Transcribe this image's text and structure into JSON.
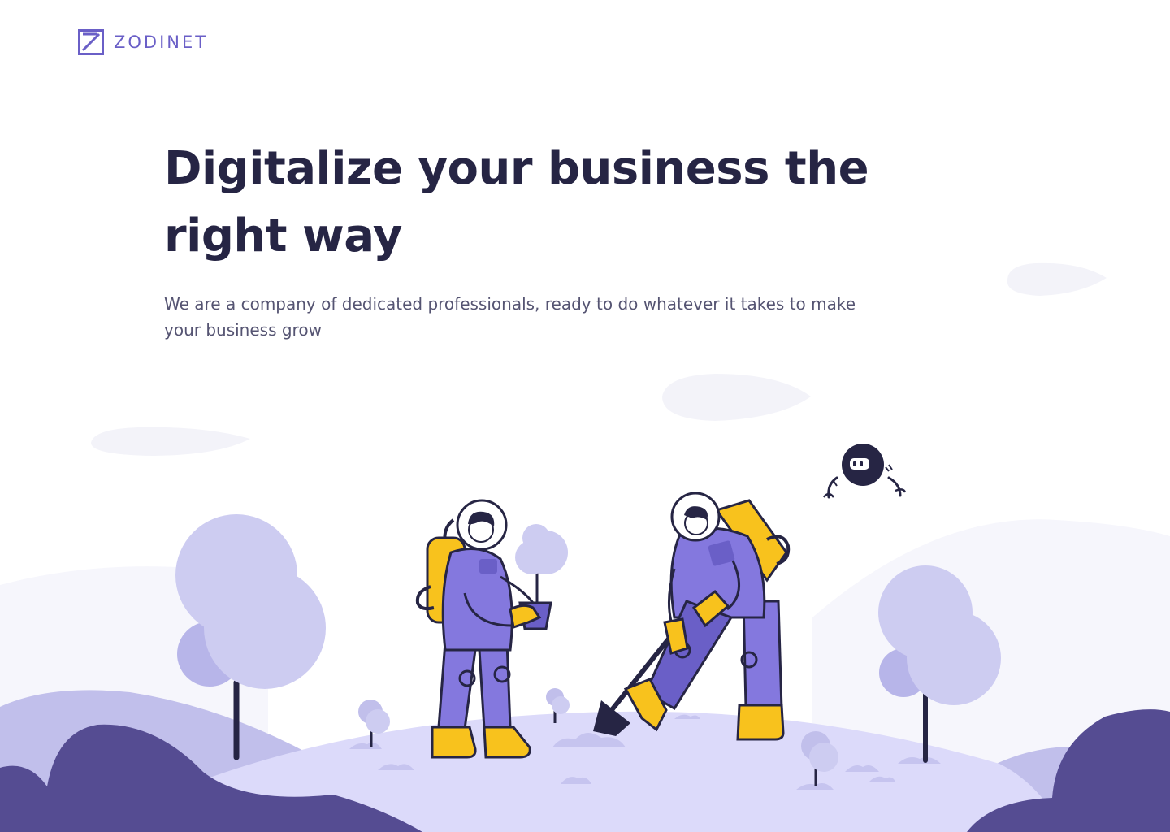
{
  "brand": {
    "name": "ZODINET",
    "color": "#6a5fc7"
  },
  "hero": {
    "title": "Digitalize your business the right way",
    "subtitle": "We are a company of dedicated professionals, ready to do whatever it takes to make your business grow"
  },
  "illustration": {
    "icons": [
      "zodinet-logo-icon",
      "astronaut-planting",
      "astronaut-digging",
      "flying-robot-icon",
      "tree",
      "cloud",
      "hill"
    ],
    "colors": {
      "hill_dark": "#554c92",
      "hill_mid": "#c1bfeb",
      "hill_light": "#dcdafa",
      "tree_light": "#cdccf1",
      "tree_mid": "#b7b5e9",
      "suit": "#8478de",
      "suit_yellow": "#f8c21d",
      "outline": "#262544",
      "cloud": "#f3f3f9"
    }
  }
}
